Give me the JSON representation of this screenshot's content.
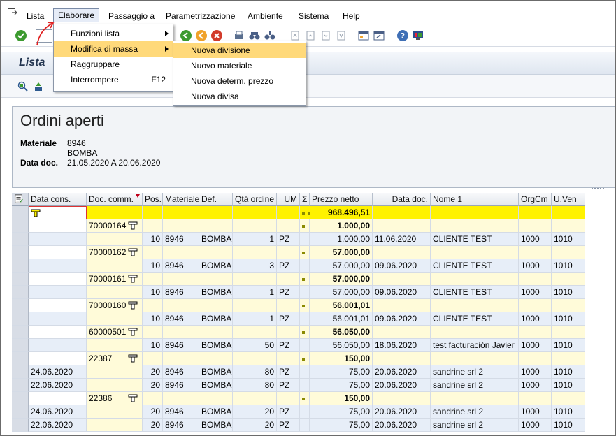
{
  "menubar": {
    "items": [
      "Lista",
      "Elaborare",
      "Passaggio a",
      "Parametrizzazione",
      "Ambiente",
      "Sistema",
      "Help"
    ]
  },
  "title": "Lista",
  "elaborare_menu": {
    "items": [
      {
        "label": "Funzioni lista",
        "submenu": true,
        "accel": ""
      },
      {
        "label": "Modifica di massa",
        "submenu": true,
        "accel": ""
      },
      {
        "label": "Raggruppare",
        "submenu": false,
        "accel": ""
      },
      {
        "label": "Interrompere",
        "submenu": false,
        "accel": "F12"
      }
    ]
  },
  "submenu": {
    "items": [
      "Nuova divisione",
      "Nuovo materiale",
      "Nuova determ. prezzo",
      "Nuova divisa"
    ]
  },
  "header": {
    "report_title": "Ordini aperti",
    "material_label": "Materiale",
    "material_code": "8946",
    "material_desc": "BOMBA",
    "date_label": "Data doc.",
    "date_range": "21.05.2020 A 20.06.2020"
  },
  "grid": {
    "columns": [
      "Data cons.",
      "Doc. comm.",
      "Pos.",
      "Materiale",
      "Def.",
      "Qtà ordine",
      "UM",
      "Σ",
      "Prezzo netto",
      "Data doc.",
      "Nome 1",
      "OrgCm",
      "U.Ven"
    ],
    "total": "968.496,51",
    "rows": [
      {
        "type": "sub",
        "doc": "70000164",
        "amount": "1.000,00"
      },
      {
        "type": "data",
        "date_cons": "",
        "pos": "10",
        "mat": "8946",
        "def": "BOMBA",
        "qty": "1",
        "um": "PZ",
        "price": "1.000,00",
        "date_doc": "11.06.2020",
        "name": "CLIENTE TEST",
        "orgcm": "1000",
        "uven": "1010"
      },
      {
        "type": "sub",
        "doc": "70000162",
        "amount": "57.000,00"
      },
      {
        "type": "data",
        "date_cons": "",
        "pos": "10",
        "mat": "8946",
        "def": "BOMBA",
        "qty": "3",
        "um": "PZ",
        "price": "57.000,00",
        "date_doc": "09.06.2020",
        "name": "CLIENTE TEST",
        "orgcm": "1000",
        "uven": "1010"
      },
      {
        "type": "sub",
        "doc": "70000161",
        "amount": "57.000,00"
      },
      {
        "type": "data",
        "date_cons": "",
        "pos": "10",
        "mat": "8946",
        "def": "BOMBA",
        "qty": "1",
        "um": "PZ",
        "price": "57.000,00",
        "date_doc": "09.06.2020",
        "name": "CLIENTE TEST",
        "orgcm": "1000",
        "uven": "1010"
      },
      {
        "type": "sub",
        "doc": "70000160",
        "amount": "56.001,01"
      },
      {
        "type": "data",
        "date_cons": "",
        "pos": "10",
        "mat": "8946",
        "def": "BOMBA",
        "qty": "1",
        "um": "PZ",
        "price": "56.001,01",
        "date_doc": "09.06.2020",
        "name": "CLIENTE TEST",
        "orgcm": "1000",
        "uven": "1010"
      },
      {
        "type": "sub",
        "doc": "60000501",
        "amount": "56.050,00"
      },
      {
        "type": "data",
        "date_cons": "",
        "pos": "10",
        "mat": "8946",
        "def": "BOMBA",
        "qty": "50",
        "um": "PZ",
        "price": "56.050,00",
        "date_doc": "18.06.2020",
        "name": "test facturación Javier",
        "orgcm": "1000",
        "uven": "1010"
      },
      {
        "type": "sub",
        "doc": "22387",
        "amount": "150,00"
      },
      {
        "type": "data",
        "date_cons": "24.06.2020",
        "pos": "20",
        "mat": "8946",
        "def": "BOMBA",
        "qty": "80",
        "um": "PZ",
        "price": "75,00",
        "date_doc": "20.06.2020",
        "name": "sandrine srl 2",
        "orgcm": "1000",
        "uven": "1010"
      },
      {
        "type": "data",
        "date_cons": "22.06.2020",
        "pos": "20",
        "mat": "8946",
        "def": "BOMBA",
        "qty": "80",
        "um": "PZ",
        "price": "75,00",
        "date_doc": "20.06.2020",
        "name": "sandrine srl 2",
        "orgcm": "1000",
        "uven": "1010"
      },
      {
        "type": "sub",
        "doc": "22386",
        "amount": "150,00"
      },
      {
        "type": "data",
        "date_cons": "24.06.2020",
        "pos": "20",
        "mat": "8946",
        "def": "BOMBA",
        "qty": "20",
        "um": "PZ",
        "price": "75,00",
        "date_doc": "20.06.2020",
        "name": "sandrine srl 2",
        "orgcm": "1000",
        "uven": "1010"
      },
      {
        "type": "data",
        "date_cons": "22.06.2020",
        "pos": "20",
        "mat": "8946",
        "def": "BOMBA",
        "qty": "20",
        "um": "PZ",
        "price": "75,00",
        "date_doc": "20.06.2020",
        "name": "sandrine srl 2",
        "orgcm": "1000",
        "uven": "1010"
      }
    ]
  },
  "colors": {
    "total_row": "#fff200",
    "subtotal_row": "#fffbd9",
    "data_row": "#e7eef8",
    "menu_highlight": "#ffd97a",
    "annotation_arrow": "#e02020"
  }
}
